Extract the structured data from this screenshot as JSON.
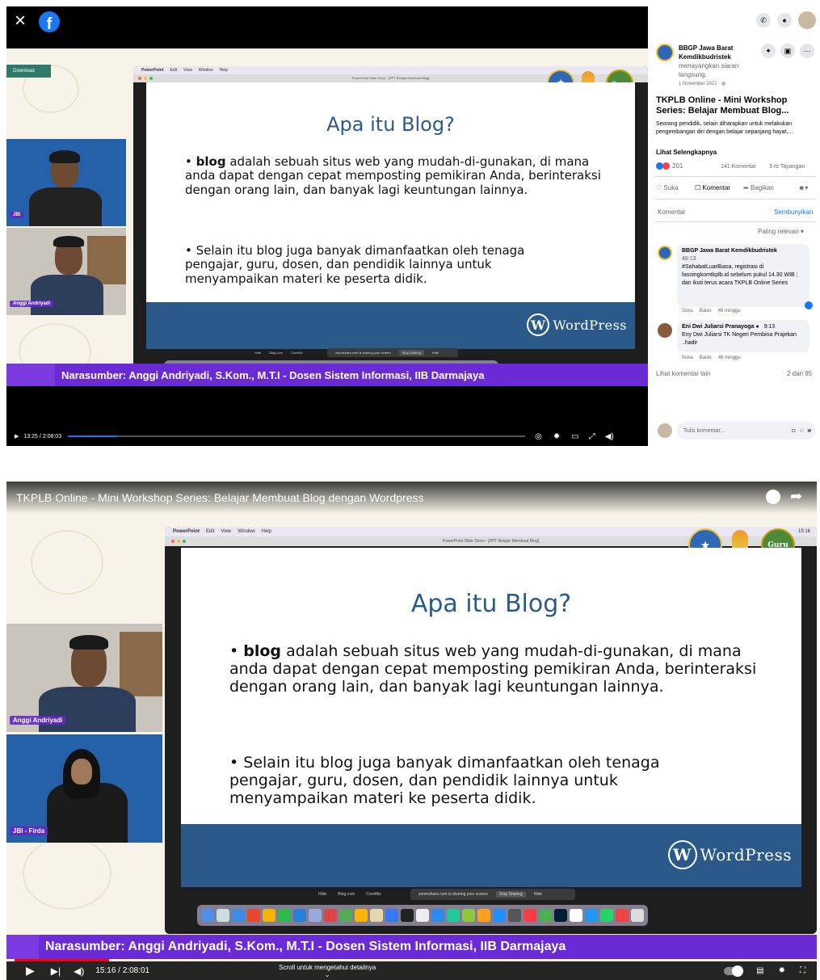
{
  "facebook": {
    "close_glyph": "×",
    "download_label": "Download",
    "time": "13:25 / 2:08:03",
    "progress_fraction": 0.107,
    "page": {
      "name": "BBGP Jawa Barat Kemdikbudristek",
      "action": "menayangkan siaran langsung.",
      "date": "1 November 2021 · ",
      "post_title": "TKPLB Online - Mini Workshop Series: Belajar Membuat Blog...",
      "post_desc": "Seorang pendidik, selain diharapkan untuk melakukan pengembangan diri dengan belajar sepanjang hayat,...",
      "see_more": "Lihat Selengkapnya"
    },
    "stats": {
      "reactions": "201",
      "comments": "141 Komentar",
      "views": "3 rb Tayangan"
    },
    "actions": {
      "like": "Suka",
      "comment": "Komentar",
      "share": "Bagikan"
    },
    "comment_header": "Komentar",
    "hide": "Sembunyikan",
    "sort": "Paling relevan",
    "comments": [
      {
        "name": "BBGP Jawa Barat Kemdikbudristek",
        "time_tag": "48:13",
        "text": "#SahabatLuarBiasa, registrasi di fasningkomtkplb.id sebelum pukul 14.30 WIB ; dan ikuti terus acara TKPLB Online Series",
        "like": "Suka",
        "reply": "Balas",
        "age": "48 minggu"
      },
      {
        "name": "Eni Dwi Juliarsi Pranayoga",
        "time_tag": "9:13",
        "text": "Eny Dwi Juliarsi TK Negeri Pembina Prajekan ..hadir",
        "like": "Suka",
        "reply": "Balas",
        "age": "48 minggu"
      }
    ],
    "more_comments": "Lihat komentar lain",
    "count": "2 dari 95",
    "write_placeholder": "Tulis komentar..."
  },
  "youtube": {
    "title": "TKPLB Online - Mini Workshop Series: Belajar Membuat Blog dengan Wordpress",
    "time": "15:16 / 2:08:01",
    "progress_fraction": 0.119,
    "scroll_hint": "Scroll untuk mengetahui detailnya",
    "scroll_arrow": "⌄"
  },
  "slide": {
    "app_menu": [
      "PowerPoint",
      "Edit",
      "View",
      "Window",
      "Help"
    ],
    "window_title": "PowerPoint Slide Show - [PPT Belajar Membuat Blog]",
    "title": "Apa itu Blog?",
    "bullet1_bold": "blog",
    "bullet1_rest": " adalah sebuah situs web yang mudah-di-gunakan, di mana anda dapat dengan cepat memposting pemikiran Anda, berinteraksi dengan orang lain, dan banyak lagi keuntungan lainnya.",
    "bullet2": "Selain itu blog juga banyak dimanfaatkan oleh tenaga pengajar, guru, dosen, dan pendidik lainnya untuk menyampaikan materi ke peserta didik.",
    "bullet_glyph": "•",
    "wp_logo": "W",
    "wp_text": "WordPress",
    "share_text": "zoomshare.com is sharing your screen",
    "share_stop": "Stop Sharing",
    "share_hide": "Hide",
    "tabs": [
      "Hide",
      "Blog.com",
      "CoreMix"
    ],
    "guru_logo": "Guru",
    "clock": "15:16"
  },
  "labels": {
    "signer_short": "JBI",
    "signer_full": "JBI - Firda",
    "speaker": "Anggi Andriyadi",
    "banner": "Narasumber: Anggi Andriyadi, S.Kom., M.T.I - Dosen Sistem Informasi, IIB Darmajaya"
  },
  "colors": {
    "banner": "#6a2bd6",
    "slide_footer": "#2b5a8a",
    "slide_title": "#2a5a8c",
    "yt_progress": "#ff0000",
    "fb_blue": "#1877f2"
  }
}
